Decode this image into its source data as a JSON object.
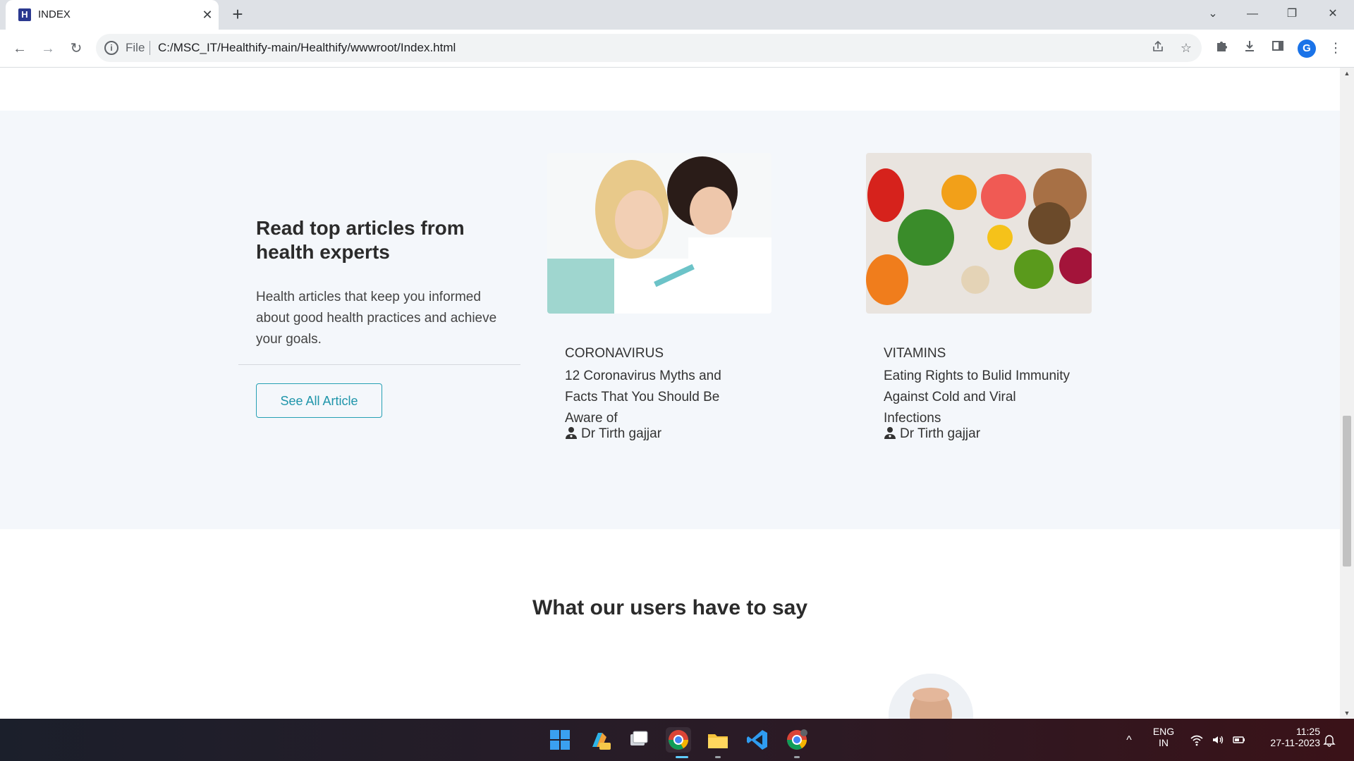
{
  "browser": {
    "tab_title": "INDEX",
    "tab_favicon_letter": "H",
    "tab_close": "✕",
    "new_tab": "+",
    "window_controls": {
      "tabs_dropdown": "⌄",
      "minimize": "—",
      "restore": "❐",
      "close": "✕"
    },
    "nav": {
      "back": "←",
      "forward": "→",
      "reload": "↻"
    },
    "address": {
      "scheme_label": "File",
      "url": "C:/MSC_IT/Healthify-main/Healthify/wwwroot/Index.html"
    },
    "profile_initial": "G"
  },
  "articles_section": {
    "heading": "Read top articles from health experts",
    "description": "Health articles that keep you informed about good health practices and achieve your goals.",
    "cta_label": "See All Article",
    "articles": [
      {
        "category": "CORONAVIRUS",
        "title": "12 Coronavirus Myths and Facts That You Should Be Aware of",
        "author": "Dr Tirth gajjar",
        "image": "doctor-giving-vaccine-photo"
      },
      {
        "category": "VITAMINS",
        "title": "Eating Rights to Bulid Immunity Against Cold and Viral Infections",
        "author": "Dr Tirth gajjar",
        "image": "fruits-vegetables-nuts-photo"
      }
    ]
  },
  "testimonials": {
    "heading": "What our users have to say"
  },
  "taskbar": {
    "language_line1": "ENG",
    "language_line2": "IN",
    "time": "11:25",
    "date": "27-11-2023",
    "apps": [
      "windows-start-icon",
      "copilot-pre-icon",
      "task-view-icon",
      "chrome-icon",
      "file-explorer-icon",
      "vscode-icon",
      "chrome-canary-icon"
    ]
  },
  "colors": {
    "accent": "#26a0b4",
    "section_bg": "#f4f7fb",
    "heading": "#2b2b2b"
  }
}
